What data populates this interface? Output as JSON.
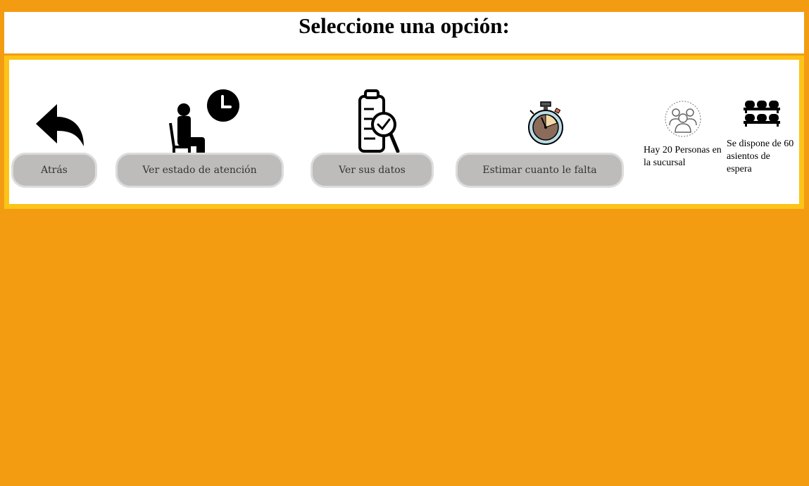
{
  "header": {
    "title": "Seleccione una opción:"
  },
  "options": [
    {
      "label": "Atrás",
      "icon": "reply-arrow-icon"
    },
    {
      "label": "Ver estado de atención",
      "icon": "waiting-person-clock-icon"
    },
    {
      "label": "Ver sus datos",
      "icon": "document-magnifier-check-icon"
    },
    {
      "label": "Estimar cuanto le falta",
      "icon": "stopwatch-icon"
    }
  ],
  "info": {
    "people": {
      "text": "Hay 20 Personas en la sucursal",
      "icon": "people-group-icon"
    },
    "seats": {
      "text": "Se dispone de 60 asientos de espera",
      "icon": "waiting-seats-icon"
    }
  },
  "colors": {
    "background": "#f39c12",
    "panel_border": "#fcc419",
    "button": "#bdbcba",
    "button_border": "#dcdcdc"
  }
}
